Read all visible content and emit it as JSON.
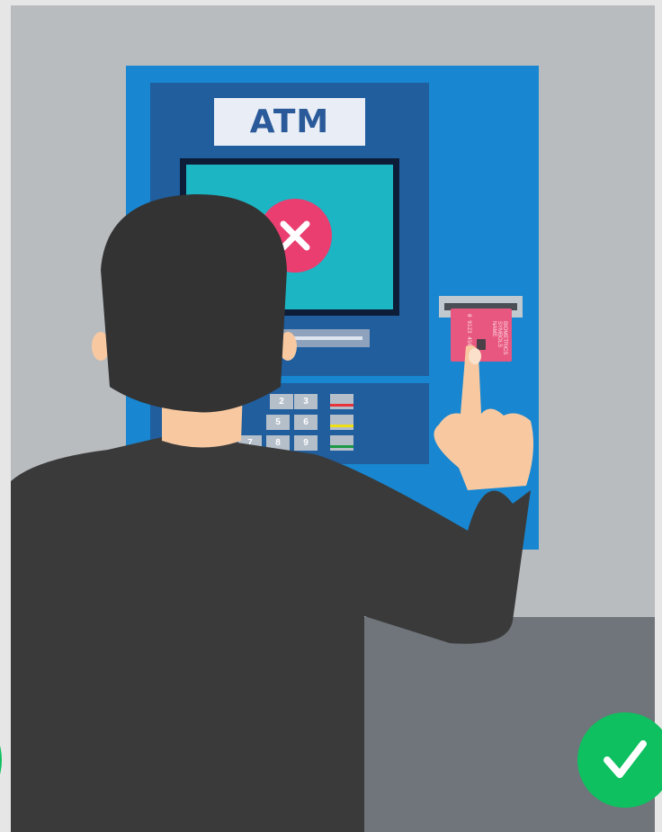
{
  "atm": {
    "sign_label": "ATM",
    "keypad": {
      "keys": [
        "2",
        "3",
        "5",
        "6",
        "7",
        "8",
        "9"
      ],
      "function_keys": [
        {
          "name": "cancel",
          "color": "#e8333b"
        },
        {
          "name": "clear",
          "color": "#f1de12"
        },
        {
          "name": "enter",
          "color": "#1b9a45"
        }
      ]
    },
    "card": {
      "number_fragment": "0 9123 456",
      "brand_text": "BIOMETRICS SYMBOLS NAME"
    },
    "screen_status_icon": "close-icon"
  },
  "status_indicator_icon": "checkmark-icon",
  "colors": {
    "wall": "#b8bcbf",
    "floor": "#6f757b",
    "atm_body": "#1886d0",
    "atm_panel": "#205e9e",
    "screen": "#1cb5c3",
    "error": "#ea3d70",
    "success": "#0ec05f",
    "card": "#e8577f",
    "hair": "#333333",
    "jacket": "#3a3a3a",
    "skin": "#f8c9a1"
  }
}
